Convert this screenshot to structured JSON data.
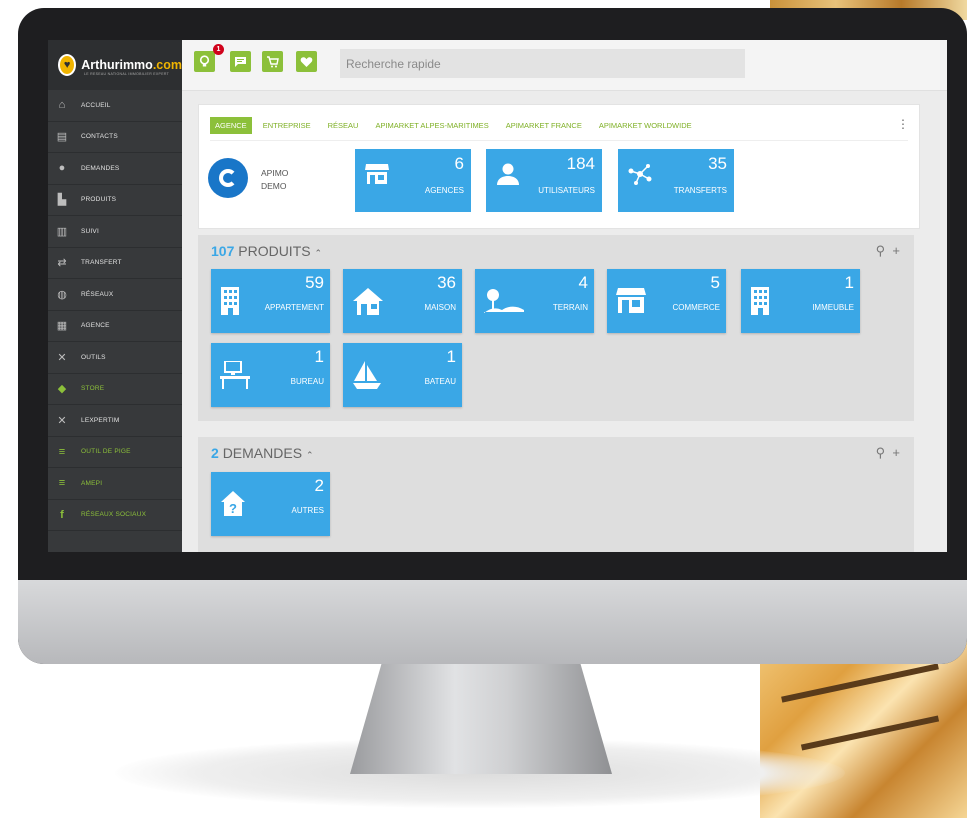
{
  "app": {
    "brand_name": "Arthurimmo",
    "brand_suffix": ".com",
    "brand_tagline": "LE RESEAU NATIONAL IMMOBILIER EXPERT"
  },
  "topbar": {
    "notification_count": "1",
    "search_placeholder": "Recherche rapide"
  },
  "sidebar": {
    "items": [
      {
        "label": "ACCUEIL",
        "icon": "home-icon"
      },
      {
        "label": "CONTACTS",
        "icon": "contacts-icon"
      },
      {
        "label": "DEMANDES",
        "icon": "requests-icon"
      },
      {
        "label": "PRODUITS",
        "icon": "products-icon"
      },
      {
        "label": "SUIVI",
        "icon": "chart-icon"
      },
      {
        "label": "TRANSFERT",
        "icon": "transfer-icon"
      },
      {
        "label": "RÉSEAUX",
        "icon": "globe-icon"
      },
      {
        "label": "AGENCE",
        "icon": "store-icon"
      },
      {
        "label": "OUTILS",
        "icon": "tools-icon"
      },
      {
        "label": "STORE",
        "icon": "bag-icon"
      },
      {
        "label": "LEXPERTIM",
        "icon": "tools-icon"
      },
      {
        "label": "OUTIL DE PIGE",
        "icon": "database-icon"
      },
      {
        "label": "AMEPI",
        "icon": "database-icon"
      },
      {
        "label": "RÉSEAUX SOCIAUX",
        "icon": "facebook-icon"
      }
    ]
  },
  "tabs": [
    "AGENCE",
    "ENTREPRISE",
    "RÉSEAU",
    "APIMARKET ALPES-MARITIMES",
    "APIMARKET FRANCE",
    "APIMARKET WORLDWIDE"
  ],
  "agency": {
    "line1": "APIMO",
    "line2": "DEMO"
  },
  "stats": [
    {
      "value": "6",
      "label": "AGENCES",
      "icon": "store-icon"
    },
    {
      "value": "184",
      "label": "UTILISATEURS",
      "icon": "user-icon"
    },
    {
      "value": "35",
      "label": "TRANSFERTS",
      "icon": "network-icon"
    }
  ],
  "produits": {
    "count": "107",
    "title": "PRODUITS",
    "tiles": [
      {
        "value": "59",
        "label": "APPARTEMENT",
        "icon": "building-icon"
      },
      {
        "value": "36",
        "label": "MAISON",
        "icon": "house-icon"
      },
      {
        "value": "4",
        "label": "TERRAIN",
        "icon": "land-icon"
      },
      {
        "value": "5",
        "label": "COMMERCE",
        "icon": "shop-icon"
      },
      {
        "value": "1",
        "label": "IMMEUBLE",
        "icon": "building-icon"
      },
      {
        "value": "1",
        "label": "BUREAU",
        "icon": "desk-icon"
      },
      {
        "value": "1",
        "label": "BATEAU",
        "icon": "boat-icon"
      }
    ]
  },
  "demandes": {
    "count": "2",
    "title": "DEMANDES",
    "tiles": [
      {
        "value": "2",
        "label": "AUTRES",
        "icon": "house-question-icon"
      }
    ]
  },
  "colors": {
    "accent_green": "#8cc03a",
    "tile_blue": "#3aa7e6",
    "sidebar": "#37393b"
  }
}
